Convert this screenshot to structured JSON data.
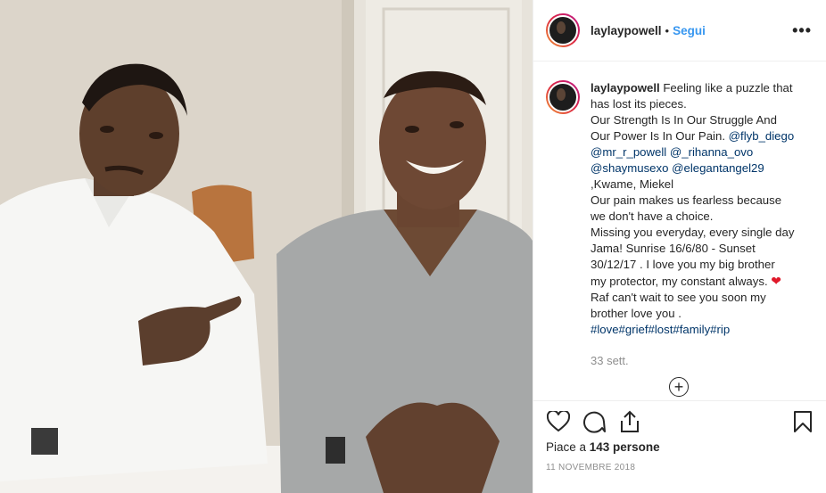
{
  "header": {
    "username": "laylaypowell",
    "separator": "•",
    "follow_label": "Segui",
    "more_label": "•••"
  },
  "caption": {
    "username": "laylaypowell",
    "lines": [
      {
        "segments": [
          {
            "text": "Feeling like a puzzle that",
            "type": "text"
          }
        ]
      },
      {
        "segments": [
          {
            "text": "has lost its pieces.",
            "type": "text"
          }
        ]
      },
      {
        "segments": [
          {
            "text": "Our Strength Is In Our Struggle And",
            "type": "text"
          }
        ]
      },
      {
        "segments": [
          {
            "text": "Our Power Is In Our Pain. ",
            "type": "text"
          },
          {
            "text": "@flyb_diego",
            "type": "tag"
          }
        ]
      },
      {
        "segments": [
          {
            "text": "@mr_r_powell",
            "type": "tag"
          },
          {
            "text": " ",
            "type": "text"
          },
          {
            "text": "@_rihanna_ovo",
            "type": "tag"
          }
        ]
      },
      {
        "segments": [
          {
            "text": "@shaymusexo",
            "type": "tag"
          },
          {
            "text": " ",
            "type": "text"
          },
          {
            "text": "@elegantangel29",
            "type": "tag"
          }
        ]
      },
      {
        "segments": [
          {
            "text": ",Kwame, Miekel",
            "type": "text"
          }
        ]
      },
      {
        "segments": [
          {
            "text": "Our pain makes us fearless because",
            "type": "text"
          }
        ]
      },
      {
        "segments": [
          {
            "text": "we don't have a choice.",
            "type": "text"
          }
        ]
      },
      {
        "segments": [
          {
            "text": "Missing you everyday, every single day",
            "type": "text"
          }
        ]
      },
      {
        "segments": [
          {
            "text": "Jama! Sunrise 16/6/80 - Sunset",
            "type": "text"
          }
        ]
      },
      {
        "segments": [
          {
            "text": "30/12/17 . I love you my big brother",
            "type": "text"
          }
        ]
      },
      {
        "segments": [
          {
            "text": "my protector, my constant always. ",
            "type": "text"
          },
          {
            "text": "❤",
            "type": "emoji"
          }
        ]
      },
      {
        "segments": [
          {
            "text": "Raf can't wait to see you soon my",
            "type": "text"
          }
        ]
      },
      {
        "segments": [
          {
            "text": "brother love you .",
            "type": "text"
          }
        ]
      },
      {
        "segments": [
          {
            "text": "#love",
            "type": "tag"
          },
          {
            "text": "#grief",
            "type": "tag"
          },
          {
            "text": "#lost",
            "type": "tag"
          },
          {
            "text": "#family",
            "type": "tag"
          },
          {
            "text": "#rip",
            "type": "tag"
          }
        ]
      }
    ],
    "time_ago": "33 sett."
  },
  "load_more_label": "+",
  "actions": {
    "like_icon": "heart-icon",
    "comment_icon": "comment-icon",
    "share_icon": "share-icon",
    "save_icon": "bookmark-icon"
  },
  "likes": {
    "prefix": "Piace a ",
    "count": "143 persone"
  },
  "date": "11 NOVEMBRE 2018",
  "colors": {
    "link": "#003569",
    "follow": "#3897f0",
    "muted": "#8e8e8e",
    "heart": "#e0192a"
  }
}
